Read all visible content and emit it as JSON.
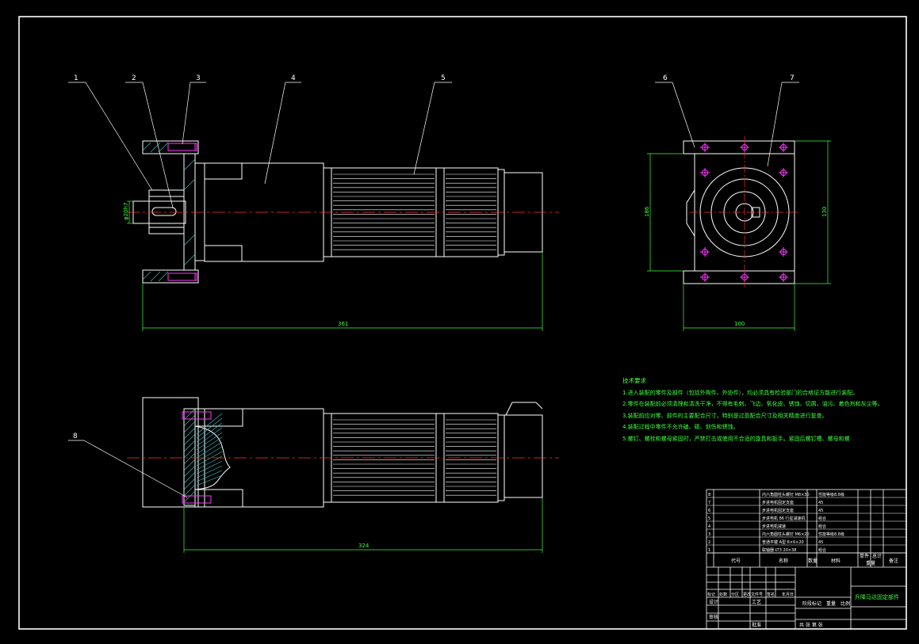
{
  "balloons": [
    "1",
    "2",
    "3",
    "4",
    "5",
    "6",
    "7",
    "8"
  ],
  "dimensions": {
    "top_length": "361",
    "bottom_length": "324",
    "side_height_left": "186",
    "side_height_right": "130",
    "side_width": "100",
    "shaft_dia": "φ20h7"
  },
  "notes": {
    "title": "技术要求",
    "items": [
      "1.进入装配的零件及部件（包括外购件、外协件），均必须具有检验部门的合格证方能进行装配。",
      "2.零件在装配前必须清理和清洗干净，不得有毛刺、飞边、氧化皮、锈蚀、切屑、油污、着色剂和灰尘等。",
      "3.装配前应对零、部件的主要配合尺寸，特别是过盈配合尺寸及相关精度进行复查。",
      "4.装配过程中零件不允许磕、碰、划伤和锈蚀。",
      "5.螺钉、螺栓和螺母紧固时，严禁打击或使用不合适的旋具和扳手。紧固后螺钉槽、螺母和螺"
    ]
  },
  "title_block": {
    "drawing_title": "升降马达固定部件",
    "header_code": "代号",
    "header_name": "名称",
    "header_qty": "数量",
    "header_material": "材料",
    "header_weight": "重量",
    "header_remark": "备注",
    "header_single": "单件",
    "header_total": "总计",
    "stage_label": "阶段标记",
    "weight_label": "重量",
    "scale_label": "比例",
    "designer_label": "设计",
    "review_label": "审核",
    "process_label": "工艺",
    "approve_label": "批准",
    "sheet_text": "共   张   第   张",
    "rev_headers": [
      "标记",
      "处数",
      "分区",
      "更改文件号",
      "签名",
      "年月日"
    ],
    "bom_rows": [
      {
        "no": "8",
        "name": "内六角圆柱头螺钉 M8×30",
        "mat": "性能等级8.8级"
      },
      {
        "no": "7",
        "name": "步进电机固定支座",
        "mat": "45"
      },
      {
        "no": "6",
        "name": "步进电机固定支座",
        "mat": "45"
      },
      {
        "no": "5",
        "name": "步进电机 86 行星减速机",
        "mat": "组合"
      },
      {
        "no": "4",
        "name": "步进电机减速",
        "mat": "组合"
      },
      {
        "no": "3",
        "name": "内六角圆柱头螺钉 M6×20",
        "mat": "性能等级8.8级"
      },
      {
        "no": "2",
        "name": "普通平键 A型 6×6×20",
        "mat": "45"
      },
      {
        "no": "1",
        "name": "联轴器 LT3 20×38",
        "mat": "组合"
      }
    ]
  },
  "colors": {
    "background": "#000000",
    "outline": "#ffffff",
    "centerline": "#ff3030",
    "dimension": "#3cff3c",
    "fastener": "#ff33ff",
    "hatch": "#3cc8c8"
  }
}
